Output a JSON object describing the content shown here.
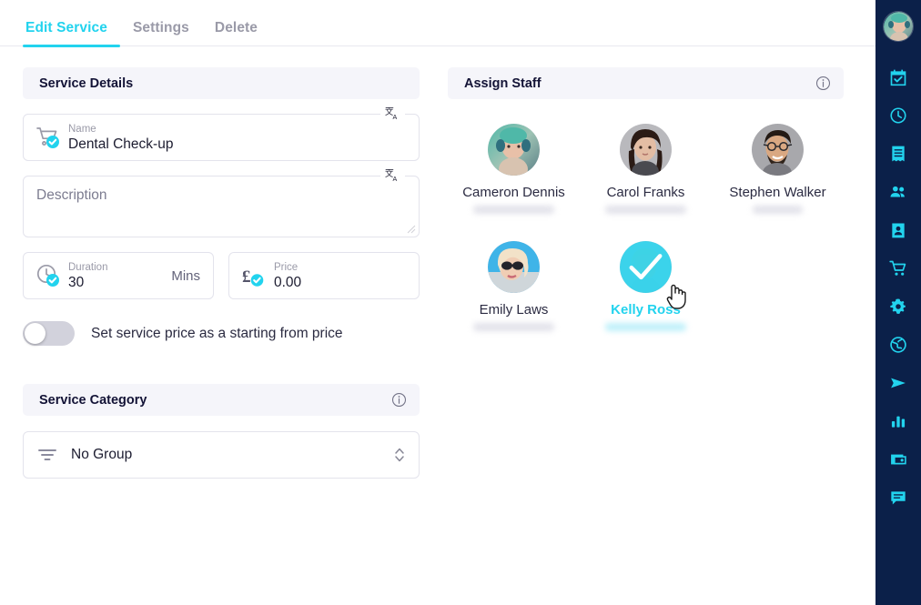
{
  "tabs": [
    {
      "label": "Edit Service",
      "active": true
    },
    {
      "label": "Settings",
      "active": false
    },
    {
      "label": "Delete",
      "active": false
    }
  ],
  "service_details": {
    "header": "Service Details",
    "name_field": {
      "label": "Name",
      "value": "Dental Check-up",
      "icon": "cart-check-icon"
    },
    "description_field": {
      "placeholder": "Description"
    },
    "duration_field": {
      "label": "Duration",
      "value": "30",
      "suffix": "Mins",
      "icon": "clock-check-icon"
    },
    "price_field": {
      "label": "Price",
      "value": "0.00",
      "icon": "pound-check-icon"
    },
    "starting_price_toggle": {
      "label": "Set service price as a starting from price",
      "on": false
    },
    "translate_icon": "translate-icon"
  },
  "service_category": {
    "header": "Service Category",
    "selected": "No Group",
    "info_icon": "info-icon"
  },
  "assign_staff": {
    "header": "Assign Staff",
    "info_icon": "info-icon",
    "members": [
      {
        "name": "Cameron Dennis",
        "selected": false,
        "subtitle_redacted": true,
        "narrow": false,
        "avatar": "cameron"
      },
      {
        "name": "Carol Franks",
        "selected": false,
        "subtitle_redacted": true,
        "narrow": false,
        "avatar": "carol"
      },
      {
        "name": "Stephen Walker",
        "selected": false,
        "subtitle_redacted": true,
        "narrow": true,
        "avatar": "stephen"
      },
      {
        "name": "Emily Laws",
        "selected": false,
        "subtitle_redacted": true,
        "narrow": false,
        "avatar": "emily"
      },
      {
        "name": "Kelly Ross",
        "selected": true,
        "subtitle_redacted": true,
        "narrow": false,
        "avatar": "kelly"
      }
    ]
  },
  "sidebar": {
    "avatar": "user-avatar",
    "items": [
      {
        "icon": "calendar-check-icon"
      },
      {
        "icon": "clock-icon"
      },
      {
        "icon": "receipt-icon"
      },
      {
        "icon": "people-icon"
      },
      {
        "icon": "contact-card-icon"
      },
      {
        "icon": "shopping-cart-icon"
      },
      {
        "icon": "gear-icon"
      },
      {
        "icon": "globe-icon"
      },
      {
        "icon": "send-icon"
      },
      {
        "icon": "bar-chart-icon"
      },
      {
        "icon": "wallet-icon"
      },
      {
        "icon": "chat-icon"
      }
    ]
  },
  "colors": {
    "accent": "#22d3ee",
    "sidebar_bg": "#0b2049",
    "section_header_bg": "#f5f5fa",
    "text_dark": "#131336",
    "text_muted": "#9a9aa8"
  },
  "cursor": {
    "type": "pointer-hand"
  }
}
